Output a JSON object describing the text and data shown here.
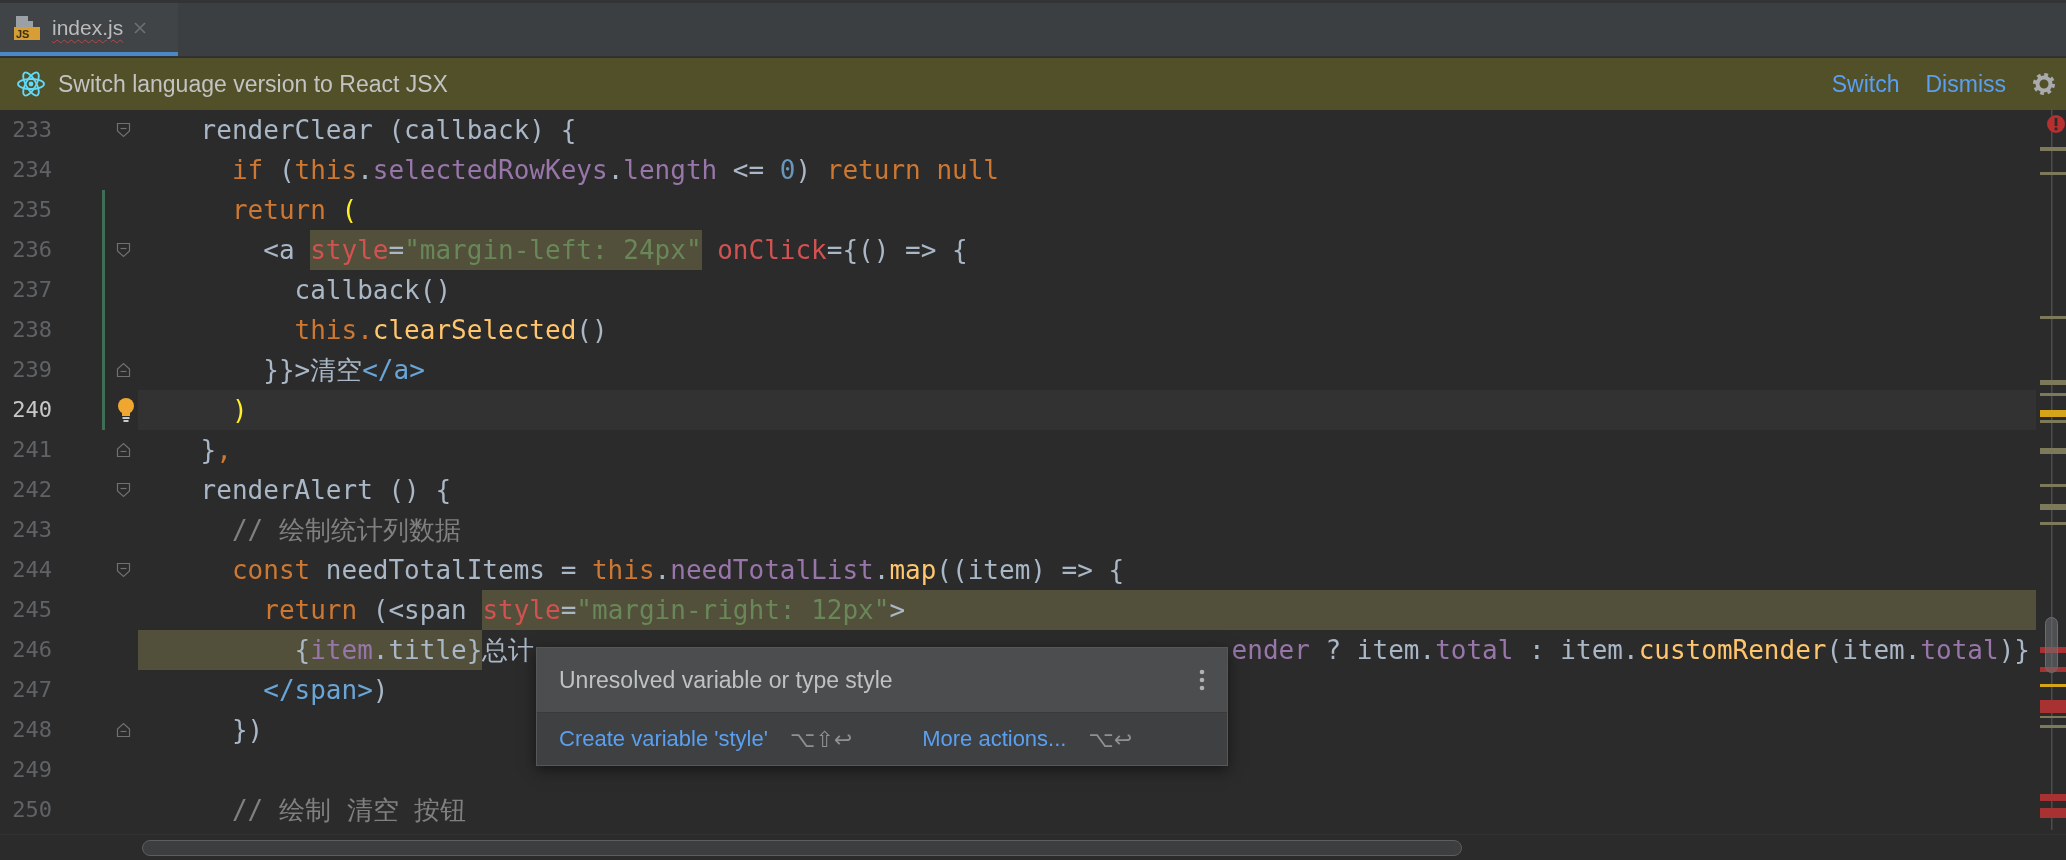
{
  "tabs": [
    {
      "label": "index.js",
      "icon_label": "JS",
      "selected": true
    }
  ],
  "banner": {
    "message": "Switch language version to React JSX",
    "actions": [
      "Switch",
      "Dismiss"
    ]
  },
  "editor": {
    "lines": [
      {
        "number": "233",
        "current": false,
        "changed": false,
        "bulb": false,
        "fold_start": true,
        "fold_end": false,
        "marked_tail": false,
        "tokens": [
          {
            "kind": "plain",
            "text": "    renderClear (callback) {"
          }
        ]
      },
      {
        "number": "234",
        "current": false,
        "changed": false,
        "bulb": false,
        "fold_start": false,
        "fold_end": false,
        "marked_tail": false,
        "tokens": [
          {
            "kind": "kw",
            "text": "      if"
          },
          {
            "kind": "plain",
            "text": " ("
          },
          {
            "kind": "kw",
            "text": "this"
          },
          {
            "kind": "plain",
            "text": "."
          },
          {
            "kind": "prop",
            "text": "selectedRowKeys"
          },
          {
            "kind": "plain",
            "text": "."
          },
          {
            "kind": "prop",
            "text": "length"
          },
          {
            "kind": "plain",
            "text": " <= "
          },
          {
            "kind": "num",
            "text": "0"
          },
          {
            "kind": "plain",
            "text": ") "
          },
          {
            "kind": "kw",
            "text": "return null"
          }
        ]
      },
      {
        "number": "235",
        "current": false,
        "changed": true,
        "bulb": false,
        "fold_start": false,
        "fold_end": false,
        "marked_tail": false,
        "tokens": [
          {
            "kind": "kw",
            "text": "      return "
          },
          {
            "kind": "match",
            "text": "("
          }
        ]
      },
      {
        "number": "236",
        "current": false,
        "changed": true,
        "bulb": false,
        "fold_start": true,
        "fold_end": false,
        "marked_tail": false,
        "tokens": [
          {
            "kind": "plain",
            "text": "        <a "
          },
          {
            "kind": "attr_hl",
            "text": "style"
          },
          {
            "kind": "plain_hl",
            "text": "="
          },
          {
            "kind": "str_hl",
            "text": "\"margin-left: 24px\""
          },
          {
            "kind": "attr",
            "text": " onClick"
          },
          {
            "kind": "plain",
            "text": "={() => {"
          }
        ]
      },
      {
        "number": "237",
        "current": false,
        "changed": true,
        "bulb": false,
        "fold_start": false,
        "fold_end": false,
        "marked_tail": false,
        "tokens": [
          {
            "kind": "plain",
            "text": "          callback()"
          }
        ]
      },
      {
        "number": "238",
        "current": false,
        "changed": true,
        "bulb": false,
        "fold_start": false,
        "fold_end": false,
        "marked_tail": false,
        "tokens": [
          {
            "kind": "kw",
            "text": "          this."
          },
          {
            "kind": "fn",
            "text": "clearSelected"
          },
          {
            "kind": "plain",
            "text": "()"
          }
        ]
      },
      {
        "number": "239",
        "current": false,
        "changed": true,
        "bulb": false,
        "fold_start": false,
        "fold_end": true,
        "marked_tail": false,
        "tokens": [
          {
            "kind": "plain",
            "text": "        }}>清空"
          },
          {
            "kind": "tag",
            "text": "</a>"
          }
        ]
      },
      {
        "number": "240",
        "current": true,
        "changed": true,
        "bulb": true,
        "fold_start": false,
        "fold_end": false,
        "marked_tail": false,
        "tokens": [
          {
            "kind": "match",
            "text": "      )"
          }
        ]
      },
      {
        "number": "241",
        "current": false,
        "changed": false,
        "bulb": false,
        "fold_start": false,
        "fold_end": true,
        "marked_tail": false,
        "tokens": [
          {
            "kind": "plain",
            "text": "    }"
          },
          {
            "kind": "kw",
            "text": ","
          }
        ]
      },
      {
        "number": "242",
        "current": false,
        "changed": false,
        "bulb": false,
        "fold_start": true,
        "fold_end": false,
        "marked_tail": false,
        "tokens": [
          {
            "kind": "plain",
            "text": "    renderAlert () {"
          }
        ]
      },
      {
        "number": "243",
        "current": false,
        "changed": false,
        "bulb": false,
        "fold_start": false,
        "fold_end": false,
        "marked_tail": false,
        "tokens": [
          {
            "kind": "comment",
            "text": "      // 绘制统计列数据"
          }
        ]
      },
      {
        "number": "244",
        "current": false,
        "changed": false,
        "bulb": false,
        "fold_start": true,
        "fold_end": false,
        "marked_tail": false,
        "tokens": [
          {
            "kind": "kw",
            "text": "      const"
          },
          {
            "kind": "plain",
            "text": " needTotalItems = "
          },
          {
            "kind": "kw",
            "text": "this"
          },
          {
            "kind": "plain",
            "text": "."
          },
          {
            "kind": "prop",
            "text": "needTotalList"
          },
          {
            "kind": "plain",
            "text": "."
          },
          {
            "kind": "fn",
            "text": "map"
          },
          {
            "kind": "plain",
            "text": "((item) => {"
          }
        ]
      },
      {
        "number": "245",
        "current": false,
        "changed": false,
        "bulb": false,
        "fold_start": false,
        "fold_end": false,
        "marked_tail": true,
        "tokens": [
          {
            "kind": "kw",
            "text": "        return"
          },
          {
            "kind": "plain",
            "text": " (<span "
          },
          {
            "kind": "attr_hl",
            "text": "style"
          },
          {
            "kind": "plain_hl",
            "text": "="
          },
          {
            "kind": "str_hl",
            "text": "\"margin-right: 12px\""
          },
          {
            "kind": "plain_hl",
            "text": ">"
          }
        ]
      },
      {
        "number": "246",
        "current": false,
        "changed": false,
        "bulb": false,
        "fold_start": false,
        "fold_end": false,
        "marked_tail": false,
        "tokens": [
          {
            "kind": "plain_hl",
            "text": "          {"
          },
          {
            "kind": "prop_hl",
            "text": "item"
          },
          {
            "kind": "plain_hl",
            "text": ".title}"
          },
          {
            "kind": "plain",
            "text": "总计"
          }
        ],
        "tokens_after": [
          {
            "kind": "prop",
            "text": "ender"
          },
          {
            "kind": "plain",
            "text": " ? item."
          },
          {
            "kind": "prop",
            "text": "total"
          },
          {
            "kind": "plain",
            "text": " : item."
          },
          {
            "kind": "fn",
            "text": "customRender"
          },
          {
            "kind": "plain",
            "text": "(item."
          },
          {
            "kind": "prop",
            "text": "total"
          },
          {
            "kind": "plain",
            "text": ")}"
          }
        ]
      },
      {
        "number": "247",
        "current": false,
        "changed": false,
        "bulb": false,
        "fold_start": false,
        "fold_end": false,
        "marked_tail": false,
        "tokens": [
          {
            "kind": "tag",
            "text": "        </span>"
          },
          {
            "kind": "plain",
            "text": ")"
          }
        ]
      },
      {
        "number": "248",
        "current": false,
        "changed": false,
        "bulb": false,
        "fold_start": false,
        "fold_end": true,
        "marked_tail": false,
        "tokens": [
          {
            "kind": "plain",
            "text": "      })"
          }
        ]
      },
      {
        "number": "249",
        "current": false,
        "changed": false,
        "bulb": false,
        "fold_start": false,
        "fold_end": false,
        "marked_tail": false
      },
      {
        "number": "250",
        "current": false,
        "changed": false,
        "bulb": false,
        "fold_start": false,
        "fold_end": false,
        "marked_tail": false,
        "tokens": [
          {
            "kind": "comment",
            "text": "      // 绘制 清空 按钮"
          }
        ]
      }
    ]
  },
  "popup": {
    "message": "Unresolved variable or type style",
    "actions": [
      {
        "label": "Create variable 'style'",
        "shortcut": "⌥⇧↩"
      },
      {
        "label": "More actions...",
        "shortcut": "⌥↩"
      }
    ]
  }
}
